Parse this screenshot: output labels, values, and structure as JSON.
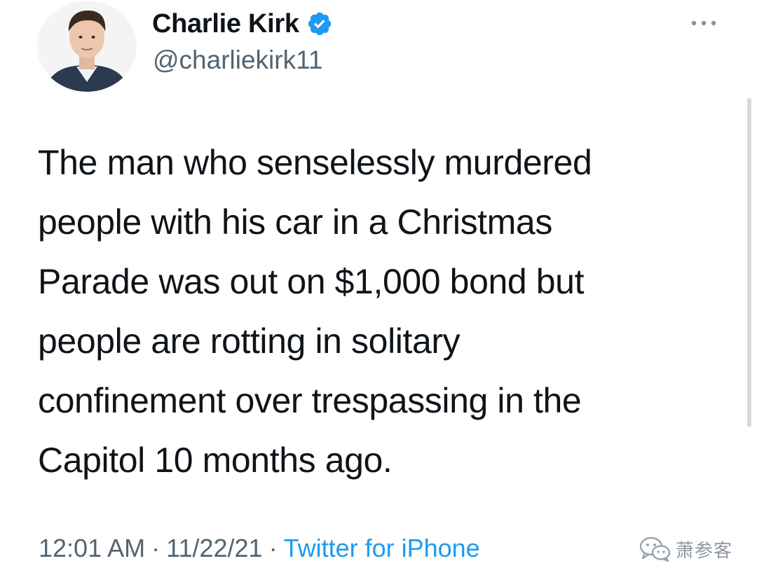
{
  "author": {
    "display_name": "Charlie Kirk",
    "handle": "@charliekirk11",
    "verified": true
  },
  "tweet": {
    "text": "The man who senselessly murdered\npeople with his car in a Christmas\nParade was out on $1,000 bond but\npeople are rotting in solitary\nconfinement over trespassing in the\nCapitol 10 months ago."
  },
  "meta": {
    "time": "12:01 AM",
    "date": "11/22/21",
    "separator": "·",
    "source": "Twitter for iPhone"
  },
  "watermark": {
    "text": "萧参客"
  },
  "icons": {
    "more": "more-horizontal-icon",
    "verified": "verified-badge-icon",
    "watermark": "wechat-icon"
  },
  "colors": {
    "text": "#0f1419",
    "secondary": "#536471",
    "link": "#1d9bf0",
    "verified": "#1d9bf0"
  }
}
